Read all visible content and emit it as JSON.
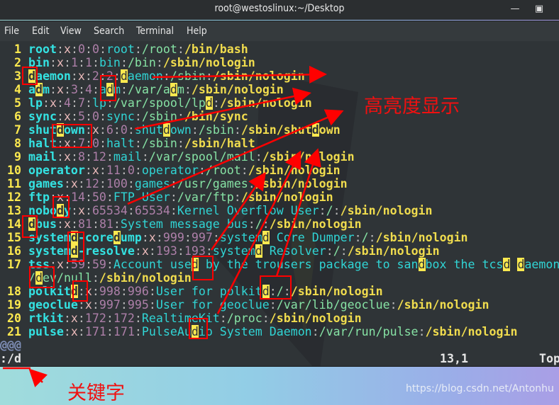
{
  "window": {
    "title": "root@westoslinux:~/Desktop",
    "minimize_icon": "minimize-icon",
    "maximize_icon": "maximize-icon"
  },
  "menu": [
    "File",
    "Edit",
    "View",
    "Search",
    "Terminal",
    "Help"
  ],
  "editor": {
    "search_char": "d",
    "lines": [
      {
        "n": "1",
        "text": "root:x:0:0:root:/root:/bin/bash"
      },
      {
        "n": "2",
        "text": "bin:x:1:1:bin:/bin:/sbin/nologin"
      },
      {
        "n": "3",
        "text": "daemon:x:2:2:daemon:/sbin:/sbin/nologin"
      },
      {
        "n": "4",
        "text": "adm:x:3:4:adm:/var/adm:/sbin/nologin"
      },
      {
        "n": "5",
        "text": "lp:x:4:7:lp:/var/spool/lpd:/sbin/nologin"
      },
      {
        "n": "6",
        "text": "sync:x:5:0:sync:/sbin:/bin/sync"
      },
      {
        "n": "7",
        "text": "shutdown:x:6:0:shutdown:/sbin:/sbin/shutdown"
      },
      {
        "n": "8",
        "text": "halt:x:7:0:halt:/sbin:/sbin/halt"
      },
      {
        "n": "9",
        "text": "mail:x:8:12:mail:/var/spool/mail:/sbin/nologin"
      },
      {
        "n": "10",
        "text": "operator:x:11:0:operator:/root:/sbin/nologin"
      },
      {
        "n": "11",
        "text": "games:x:12:100:games:/usr/games:/sbin/nologin"
      },
      {
        "n": "12",
        "text": "ftp:x:14:50:FTP User:/var/ftp:/sbin/nologin"
      },
      {
        "n": "13",
        "text": "nobody:x:65534:65534:Kernel Overflow User:/:/sbin/nologin"
      },
      {
        "n": "14",
        "text": "dbus:x:81:81:System message bus:/:/sbin/nologin"
      },
      {
        "n": "15",
        "text": "systemd-coredump:x:999:997:systemd Core Dumper:/:/sbin/nologin"
      },
      {
        "n": "16",
        "text": "systemd-resolve:x:193:193:systemd Resolver:/:/sbin/nologin"
      },
      {
        "n": "17",
        "text": "tss:x:59:59:Account used by the trousers package to sandbox the tcsd daemon:/dev/null:/sbin/nologin"
      },
      {
        "n": "18",
        "text": "polkitd:x:998:996:User for polkitd:/:/sbin/nologin"
      },
      {
        "n": "19",
        "text": "geoclue:x:997:995:User for geoclue:/var/lib/geoclue:/sbin/nologin"
      },
      {
        "n": "20",
        "text": "rtkit:x:172:172:RealtimeKit:/proc:/sbin/nologin"
      },
      {
        "n": "21",
        "text": "pulse:x:171:171:PulseAudio System Daemon:/var/run/pulse:/sbin/nologin"
      }
    ],
    "filler": "@@@",
    "command": ":/d",
    "cursor_position": "13,1",
    "scroll_position": "Top"
  },
  "annotations": {
    "highlight_note": "高亮度显示",
    "keyword_note": "关键字",
    "color": "#ff0000"
  },
  "watermark": "https://blog.csdn.net/Antonhu"
}
